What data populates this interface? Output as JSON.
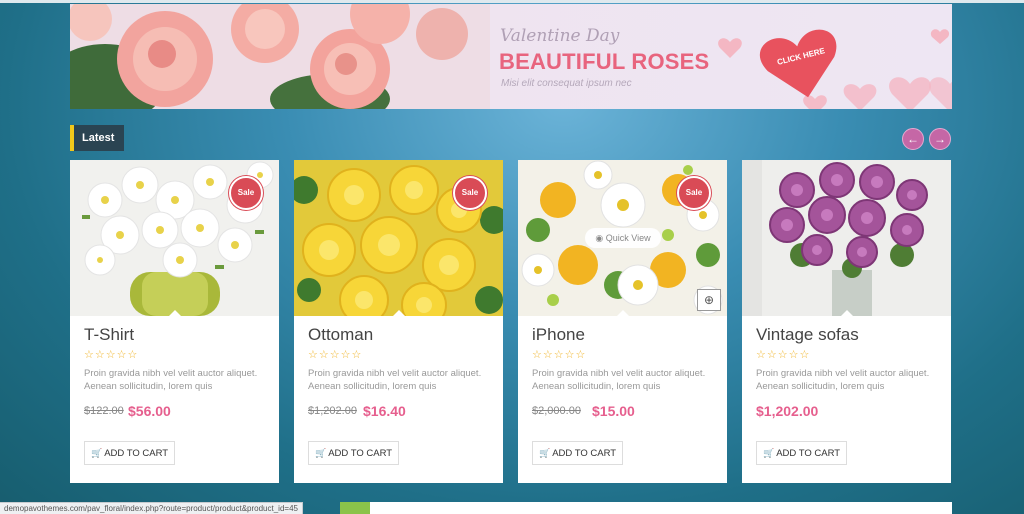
{
  "banner": {
    "kicker": "Valentine Day",
    "headline": "BEAUTIFUL ROSES",
    "subtext": "Misi elit consequat ipsum nec",
    "cta": "CLICK HERE"
  },
  "section": {
    "title": "Latest",
    "prev_icon": "←",
    "next_icon": "→"
  },
  "sale_label": "Sale",
  "quick_view_label": "Quick View",
  "add_to_cart_label": "ADD TO CART",
  "rating_stars": "☆☆☆☆☆",
  "products": [
    {
      "name": "T-Shirt",
      "description": "Proin gravida nibh vel velit auctor aliquet. Aenean sollicitudin, lorem quis",
      "old_price": "$122.00",
      "price": "$56.00"
    },
    {
      "name": "Ottoman",
      "description": "Proin gravida nibh vel velit auctor aliquet. Aenean sollicitudin, lorem quis",
      "old_price": "$1,202.00",
      "price": "$16.40"
    },
    {
      "name": "iPhone",
      "description": "Proin gravida nibh vel velit auctor aliquet. Aenean sollicitudin, lorem quis",
      "old_price": "$2,000.00",
      "price": "$15.00"
    },
    {
      "name": "Vintage sofas",
      "description": "Proin gravida nibh vel velit auctor aliquet. Aenean sollicitudin, lorem quis",
      "price": "$1,202.00"
    }
  ],
  "status_url": "demopavothemes.com/pav_floral/index.php?route=product/product&product_id=45",
  "colors": {
    "accent_pink": "#e65f8e",
    "sale_red": "#d94b56",
    "section_yellow": "#f2c81a",
    "nav_purple": "#c567a6"
  }
}
